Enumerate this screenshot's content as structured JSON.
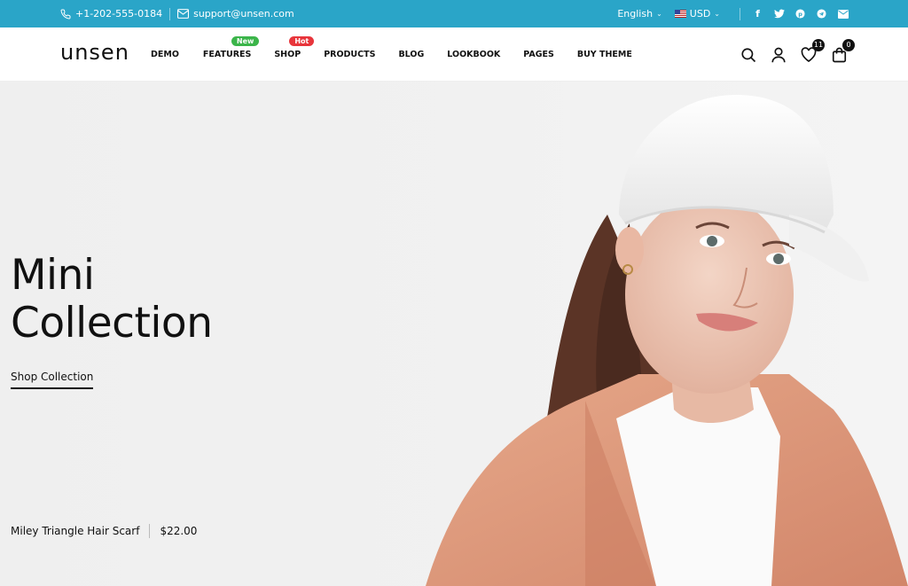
{
  "topbar": {
    "phone": "+1-202-555-0184",
    "email": "support@unsen.com",
    "language": "English",
    "currency": "USD",
    "social_icons": [
      "facebook-icon",
      "twitter-icon",
      "pinterest-icon",
      "telegram-icon",
      "email-icon"
    ],
    "bg_color": "#2aa5c8"
  },
  "header": {
    "logo": "unsen",
    "nav": [
      {
        "label": "DEMO"
      },
      {
        "label": "FEATURES",
        "badge": "New",
        "badge_color": "#3bb54a"
      },
      {
        "label": "SHOP",
        "badge": "Hot",
        "badge_color": "#e8353b"
      },
      {
        "label": "PRODUCTS"
      },
      {
        "label": "BLOG"
      },
      {
        "label": "LOOKBOOK"
      },
      {
        "label": "PAGES"
      },
      {
        "label": "BUY THEME"
      }
    ],
    "wishlist_count": "11",
    "cart_count": "0"
  },
  "hero": {
    "title_line1": "Mini",
    "title_line2": "Collection",
    "cta": "Shop Collection",
    "product_name": "Miley Triangle Hair Scarf",
    "product_price": "$22.00"
  }
}
